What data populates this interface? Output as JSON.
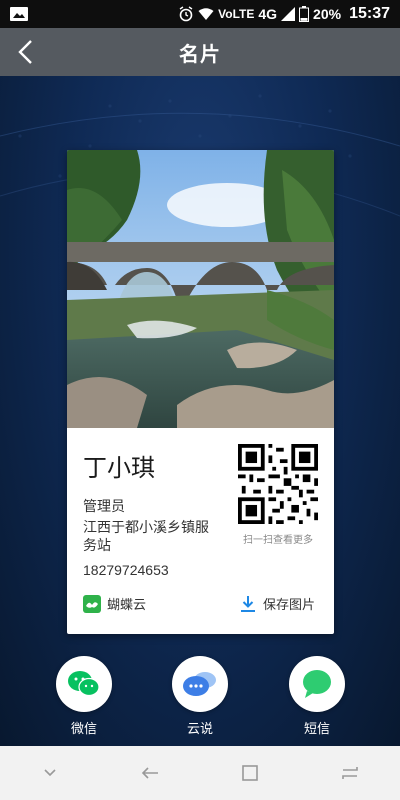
{
  "status_bar": {
    "network": "VoLTE",
    "signal": "4G",
    "battery": "20%",
    "time": "15:37"
  },
  "header": {
    "title": "名片"
  },
  "card": {
    "name": "丁小琪",
    "role": "管理员",
    "org": "江西于都小溪乡镇服务站",
    "phone": "18279724653",
    "qr_caption": "扫一扫查看更多",
    "brand": "蝴蝶云",
    "save_label": "保存图片"
  },
  "share": [
    {
      "label": "微信",
      "icon": "wechat-icon",
      "color": "#07c160"
    },
    {
      "label": "云说",
      "icon": "yunshuo-icon",
      "color": "#3d7ee6"
    },
    {
      "label": "短信",
      "icon": "sms-icon",
      "color": "#2ecc71"
    }
  ],
  "nav": {
    "icons": [
      "chevron-down-icon",
      "back-arrow-icon",
      "square-icon",
      "recents-icon"
    ]
  },
  "colors": {
    "accent": "#1e88e5",
    "header_bg": "#555a60",
    "background": "#0b1e3c"
  }
}
